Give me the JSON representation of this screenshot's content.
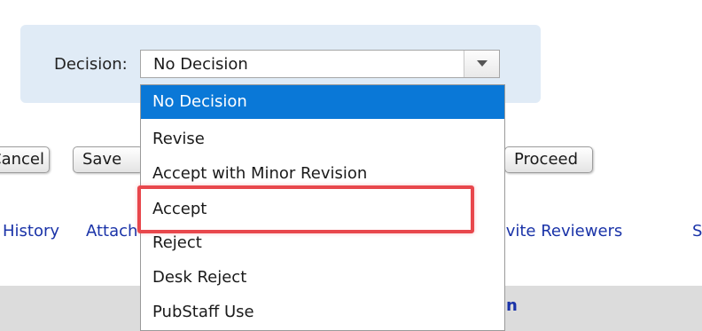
{
  "decision": {
    "label": "Decision:",
    "selected_value": "No Decision",
    "options": [
      "No Decision",
      "Revise",
      "Accept with Minor Revision",
      "Accept",
      "Reject",
      "Desk Reject",
      "PubStaff Use"
    ],
    "highlighted_option": "Accept"
  },
  "buttons": {
    "cancel_label": "Cancel",
    "save_label": "Save",
    "proceed_label": "Proceed"
  },
  "links": {
    "history": "History",
    "attach": "Attach",
    "invite_reviewers": "Invite Reviewers",
    "extra": "S"
  },
  "footer": {
    "text": "n"
  },
  "colors": {
    "panel_bg": "#e0ebf6",
    "selected_bg": "#0a78d7",
    "link": "#1a33a8",
    "highlight": "#e8474c",
    "bottom_bar": "#dcdcdc"
  },
  "icons": {
    "dropdown_arrow": "triangle-down-icon"
  }
}
